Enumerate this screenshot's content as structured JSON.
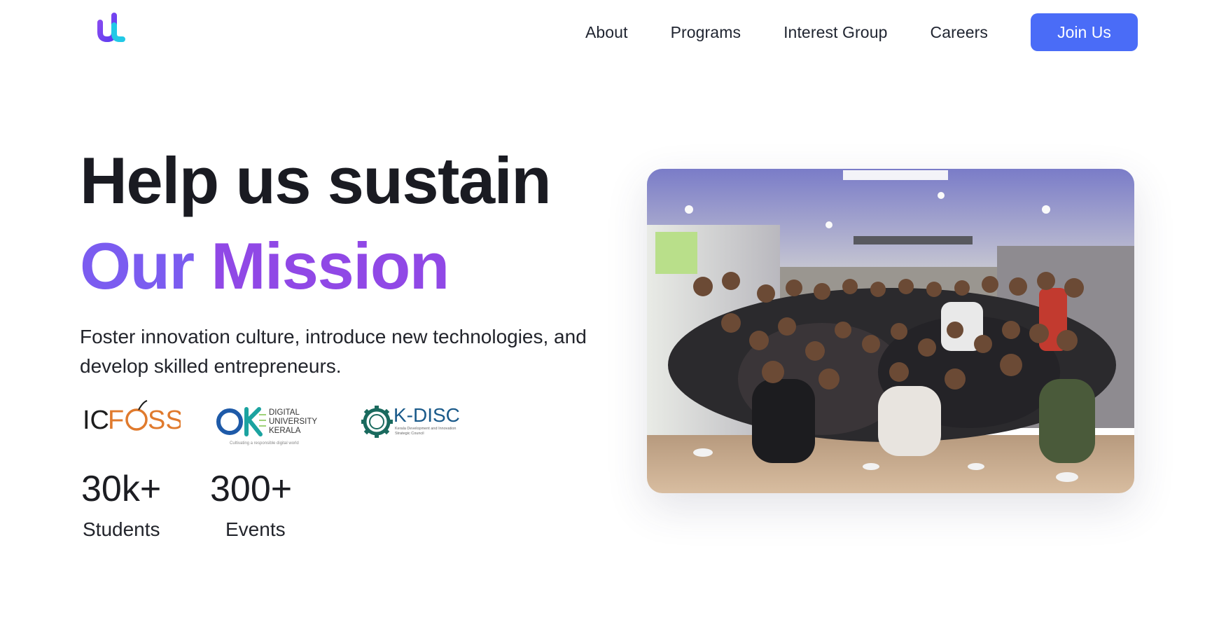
{
  "nav": {
    "logo": "mu-logo",
    "links": [
      "About",
      "Programs",
      "Interest Group",
      "Careers"
    ],
    "cta": "Join Us"
  },
  "hero": {
    "title_line1": "Help us sustain",
    "title_line2_word1": "Our",
    "title_line2_word2": "Mission",
    "description": "Foster innovation culture, introduce new technologies, and develop skilled entrepreneurs."
  },
  "partners": {
    "icfoss": {
      "name": "ICFOSS",
      "text_left": "IC",
      "text_right": "SS"
    },
    "duk": {
      "line1": "DIGITAL",
      "line2": "UNIVERSITY",
      "line3": "KERALA",
      "tagline": "Cultivating a responsible digital world"
    },
    "kdisc": {
      "name": "K-DISC",
      "tagline_line1": "Kerala Development and Innovation",
      "tagline_line2": "Strategic Council"
    }
  },
  "stats": [
    {
      "value": "30k+",
      "label": "Students"
    },
    {
      "value": "300+",
      "label": "Events"
    }
  ],
  "colors": {
    "accent_blue": "#4a6cf7",
    "gradient_purple_start": "#7b5cf0",
    "gradient_purple_end": "#9048e6",
    "heading_dark": "#1a1b22"
  },
  "image": {
    "description": "group-photo"
  }
}
